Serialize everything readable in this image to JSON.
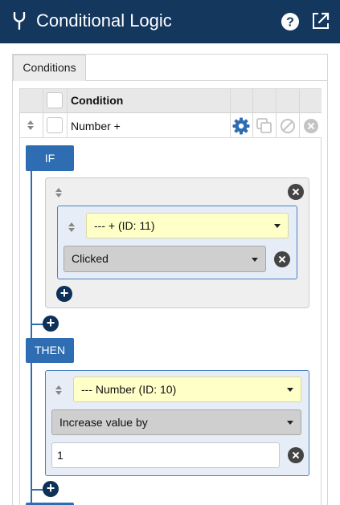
{
  "header": {
    "title": "Conditional Logic",
    "logo_icon": "branch-fork-icon",
    "help_icon": "help-icon",
    "expand_icon": "expand-icon"
  },
  "tabs": [
    {
      "label": "Conditions",
      "active": true
    }
  ],
  "grid": {
    "column_header": "Condition",
    "rows": [
      {
        "label": "Number +",
        "actions": [
          "settings-icon",
          "copy-icon",
          "disable-icon",
          "delete-icon"
        ]
      }
    ]
  },
  "if_block": {
    "label": "IF",
    "conditions": [
      {
        "field": "--- + (ID: 11)",
        "operator": "Clicked"
      }
    ]
  },
  "then_block": {
    "label": "THEN",
    "actions": [
      {
        "field": "--- Number (ID: 10)",
        "action": "Increase value by",
        "value": "1"
      }
    ]
  },
  "colors": {
    "header_bg": "#14375e",
    "accent_blue": "#2e6db2",
    "dark_navy": "#0d3159",
    "field_yellow": "#ffffc8"
  }
}
